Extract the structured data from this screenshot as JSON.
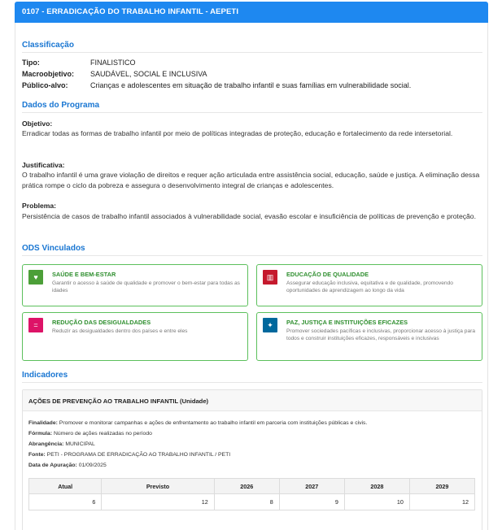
{
  "header": {
    "title": "0107 - ERRADICAÇÃO DO TRABALHO INFANTIL - AEPETI"
  },
  "classificacao": {
    "heading": "Classificação",
    "tipo_label": "Tipo:",
    "tipo": "FINALISTICO",
    "macro_label": "Macroobjetivo:",
    "macro": "SAUDÁVEL, SOCIAL E INCLUSIVA",
    "publico_label": "Público-alvo:",
    "publico": "Crianças e adolescentes em situação de trabalho infantil e suas famílias em vulnerabilidade social."
  },
  "programa": {
    "heading": "Dados do Programa",
    "objetivo_label": "Objetivo:",
    "objetivo": "Erradicar todas as formas de trabalho infantil por meio de políticas integradas de proteção, educação e fortalecimento da rede intersetorial.",
    "justificativa_label": "Justificativa:",
    "justificativa": "O trabalho infantil é uma grave violação de direitos e requer ação articulada entre assistência social, educação, saúde e justiça. A eliminação dessa prática rompe o ciclo da pobreza e assegura o desenvolvimento integral de crianças e adolescentes.",
    "problema_label": "Problema:",
    "problema": "Persistência de casos de trabalho infantil associados à vulnerabilidade social, evasão escolar e insuficiência de políticas de prevenção e proteção."
  },
  "ods": {
    "heading": "ODS Vinculados",
    "items": [
      {
        "title": "SAÚDE E BEM-ESTAR",
        "desc": "Garantir o acesso à saúde de qualidade e promover o bem-estar para todas as idades",
        "color": "#4c9f38",
        "icon": "heartbeat-icon"
      },
      {
        "title": "EDUCAÇÃO DE QUALIDADE",
        "desc": "Assegurar educação inclusiva, equitativa e de qualidade, promovendo oportunidades de aprendizagem ao longo da vida",
        "color": "#c5192d",
        "icon": "book-icon"
      },
      {
        "title": "REDUÇÃO DAS DESIGUALDADES",
        "desc": "Reduzir as desigualdades dentro dos países e entre eles",
        "color": "#dd1367",
        "icon": "equality-icon"
      },
      {
        "title": "PAZ, JUSTIÇA E INSTITUIÇÕES EFICAZES",
        "desc": "Promover sociedades pacíficas e inclusivas, proporcionar acesso à justiça para todos e construir instituições eficazes, responsáveis e inclusivas",
        "color": "#00689d",
        "icon": "dove-icon"
      }
    ]
  },
  "indicadores": {
    "heading": "Indicadores",
    "title": "AÇÕES DE PREVENÇÃO AO TRABALHO INFANTIL (Unidade)",
    "finalidade_label": "Finalidade:",
    "finalidade": "Promover e monitorar campanhas e ações de enfrentamento ao trabalho infantil em parceria com instituições públicas e civis.",
    "formula_label": "Fórmula:",
    "formula": "Número de ações realizadas no período",
    "abrangencia_label": "Abrangência:",
    "abrangencia": "MUNICIPAL",
    "fonte_label": "Fonte:",
    "fonte": "PETI - PROGRAMA DE ERRADICAÇÃO AO TRABALHO INFANTIL / PETI",
    "data_label": "Data de Apuração:",
    "data": "01/09/2025",
    "table": {
      "headers": [
        "Atual",
        "Previsto",
        "2026",
        "2027",
        "2028",
        "2029"
      ],
      "values": [
        "6",
        "12",
        "8",
        "9",
        "10",
        "12"
      ]
    }
  }
}
